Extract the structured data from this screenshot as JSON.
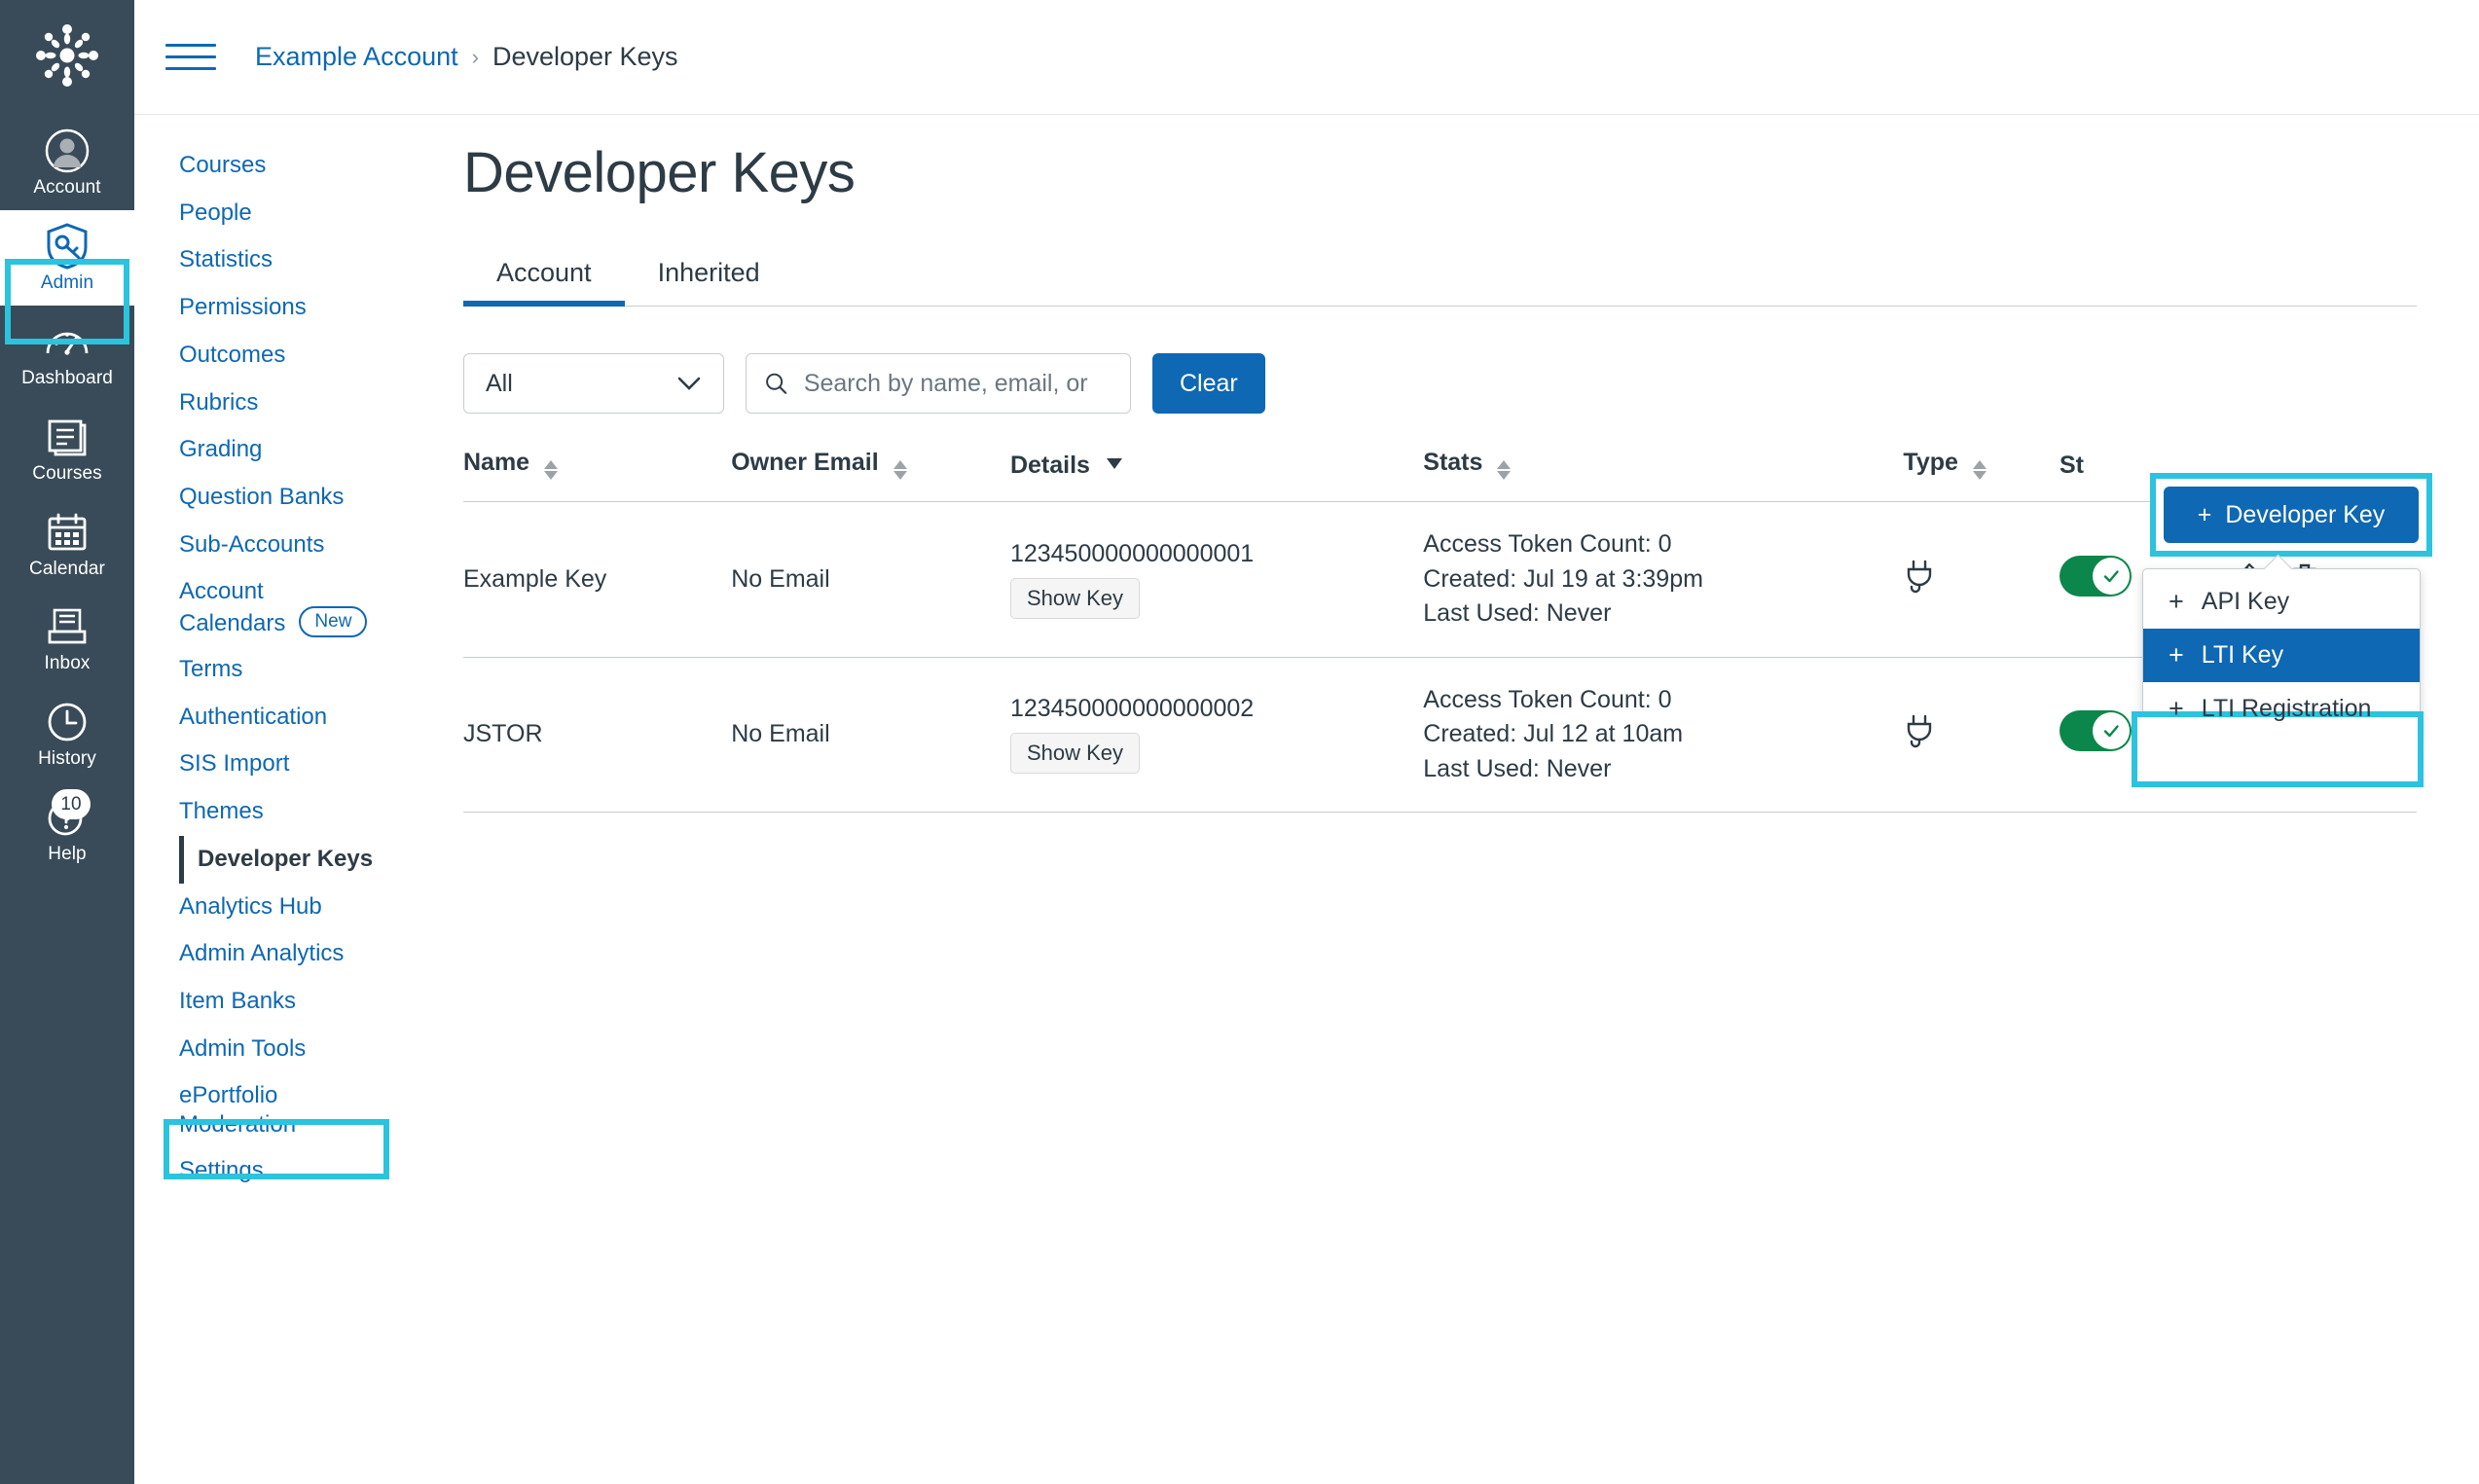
{
  "global_nav": {
    "logo_name": "canvas-logo",
    "items": [
      {
        "label": "Account",
        "icon": "user-avatar-icon",
        "active": false
      },
      {
        "label": "Admin",
        "icon": "shield-key-icon",
        "active": true
      },
      {
        "label": "Dashboard",
        "icon": "dashboard-icon",
        "active": false
      },
      {
        "label": "Courses",
        "icon": "courses-book-icon",
        "active": false
      },
      {
        "label": "Calendar",
        "icon": "calendar-icon",
        "active": false
      },
      {
        "label": "Inbox",
        "icon": "inbox-tray-icon",
        "active": false
      },
      {
        "label": "History",
        "icon": "clock-icon",
        "active": false
      },
      {
        "label": "Help",
        "icon": "question-mark-icon",
        "active": false,
        "badge": "10"
      }
    ]
  },
  "breadcrumb": {
    "account_label": "Example Account",
    "separator": "›",
    "current_label": "Developer Keys"
  },
  "subnav": {
    "items": [
      {
        "label": "Courses",
        "current": false
      },
      {
        "label": "People",
        "current": false
      },
      {
        "label": "Statistics",
        "current": false
      },
      {
        "label": "Permissions",
        "current": false
      },
      {
        "label": "Outcomes",
        "current": false
      },
      {
        "label": "Rubrics",
        "current": false
      },
      {
        "label": "Grading",
        "current": false
      },
      {
        "label": "Question Banks",
        "current": false
      },
      {
        "label": "Sub-Accounts",
        "current": false
      },
      {
        "label": "Account Calendars",
        "current": false,
        "badge": "New"
      },
      {
        "label": "Terms",
        "current": false
      },
      {
        "label": "Authentication",
        "current": false
      },
      {
        "label": "SIS Import",
        "current": false
      },
      {
        "label": "Themes",
        "current": false
      },
      {
        "label": "Developer Keys",
        "current": true
      },
      {
        "label": "Analytics Hub",
        "current": false
      },
      {
        "label": "Admin Analytics",
        "current": false
      },
      {
        "label": "Item Banks",
        "current": false
      },
      {
        "label": "Admin Tools",
        "current": false
      },
      {
        "label": "ePortfolio Moderation",
        "current": false
      },
      {
        "label": "Settings",
        "current": false
      }
    ]
  },
  "main": {
    "page_title": "Developer Keys",
    "tabs": [
      {
        "label": "Account",
        "active": true
      },
      {
        "label": "Inherited",
        "active": false
      }
    ],
    "toolbar": {
      "filter_value": "All",
      "search_placeholder": "Search by name, email, or",
      "search_value": "",
      "clear_label": "Clear"
    },
    "add_key": {
      "button_label": "Developer Key",
      "plus": "+",
      "menu": [
        {
          "label": "API Key",
          "selected": false
        },
        {
          "label": "LTI Key",
          "selected": true
        },
        {
          "label": "LTI Registration",
          "selected": false
        }
      ]
    },
    "table": {
      "headers": {
        "name": "Name",
        "owner_email": "Owner Email",
        "details": "Details",
        "stats": "Stats",
        "type": "Type",
        "state": "St",
        "actions": ""
      },
      "rows": [
        {
          "name": "Example Key",
          "owner_email": "No Email",
          "key_id": "123450000000000001",
          "show_key_label": "Show Key",
          "stat_token_count": "Access Token Count: 0",
          "stat_created": "Created: Jul 19 at 3:39pm",
          "stat_last_used": "Last Used: Never",
          "type_icon": "lti-plug-icon",
          "state_on": true
        },
        {
          "name": "JSTOR",
          "owner_email": "No Email",
          "key_id": "123450000000000002",
          "show_key_label": "Show Key",
          "stat_token_count": "Access Token Count: 0",
          "stat_created": "Created: Jul 12 at 10am",
          "stat_last_used": "Last Used: Never",
          "type_icon": "lti-plug-icon",
          "state_on": true
        }
      ]
    }
  },
  "colors": {
    "brand_blue": "#0E68B3",
    "nav_dark": "#394B58",
    "highlight_cyan": "#2BC3DE",
    "toggle_green": "#0B874B",
    "text_dark": "#2D3B45"
  }
}
